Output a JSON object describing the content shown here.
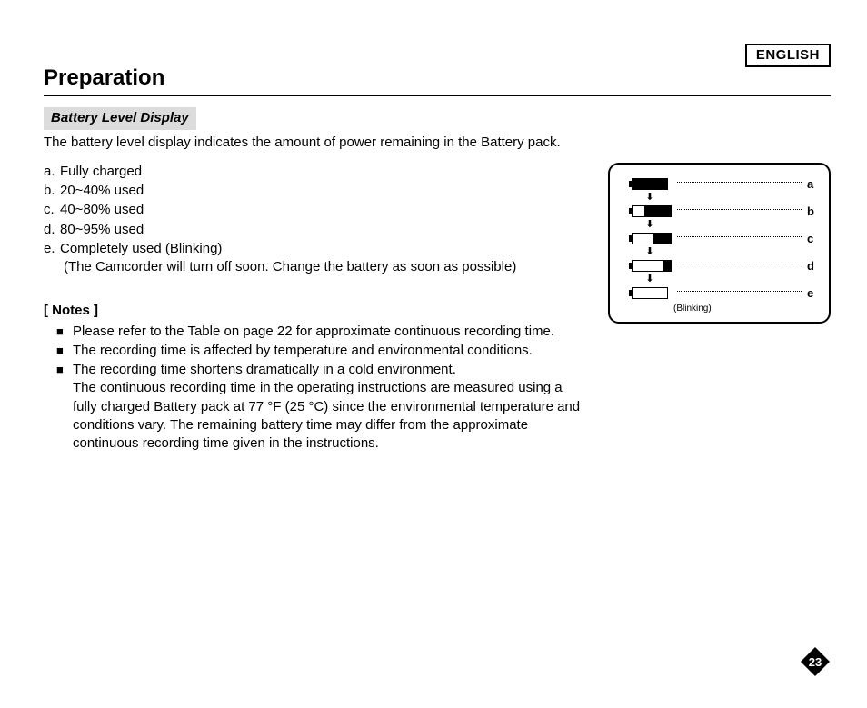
{
  "language_label": "ENGLISH",
  "title": "Preparation",
  "subheading": "Battery Level Display",
  "intro": "The battery level display indicates the amount of power remaining in the Battery pack.",
  "levels": [
    {
      "key": "a.",
      "text": "Fully charged"
    },
    {
      "key": "b.",
      "text": "20~40% used"
    },
    {
      "key": "c.",
      "text": "40~80% used"
    },
    {
      "key": "d.",
      "text": "80~95% used"
    },
    {
      "key": "e.",
      "text": "Completely used (Blinking)",
      "sub": "(The Camcorder will turn off soon. Change the battery as soon as possible)"
    }
  ],
  "diagram": {
    "labels": [
      "a",
      "b",
      "c",
      "d",
      "e"
    ],
    "blinking_label": "(Blinking)"
  },
  "notes_heading": "[ Notes ]",
  "notes": [
    {
      "text": "Please refer to the Table on page 22 for approximate continuous recording time."
    },
    {
      "text": "The recording time is affected by temperature and environmental conditions."
    },
    {
      "text": "The recording time shortens dramatically in a cold environment.",
      "extra": "The continuous recording time in the operating instructions are measured using a fully charged Battery pack at 77 °F (25 °C) since the environmental temperature and conditions vary. The remaining battery time may differ from the approximate continuous recording time given in the instructions."
    }
  ],
  "page_number": "23"
}
